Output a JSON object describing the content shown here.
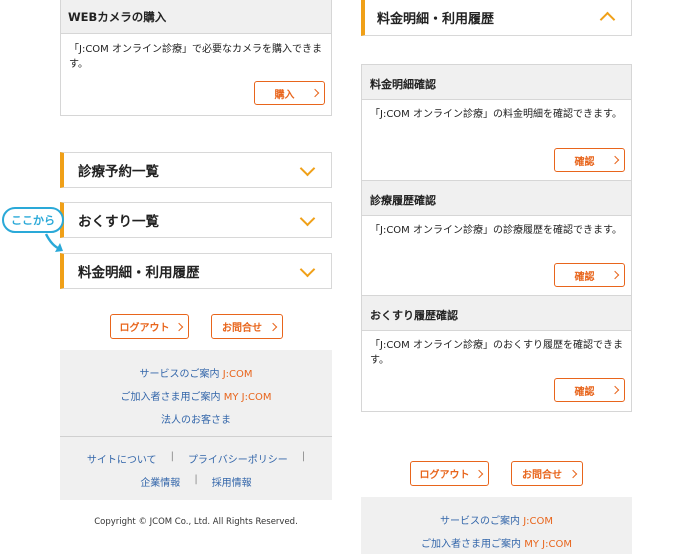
{
  "left": {
    "camera": {
      "title": "WEBカメラの購入",
      "text": "「J:COM オンライン診療」で必要なカメラを購入できます。",
      "button": "購入"
    },
    "accordions": [
      {
        "label": "診療予約一覧"
      },
      {
        "label": "おくすり一覧"
      },
      {
        "label": "料金明細・利用履歴"
      }
    ],
    "callout": "ここから",
    "logout": "ログアウト",
    "contact": "お問合せ",
    "footer": {
      "service_prefix": "サービスのご案内",
      "service_brand": "J:COM",
      "member_prefix": "ご加入者さま用ご案内",
      "member_brand": "MY J:COM",
      "corporate": "法人のお客さま",
      "about": "サイトについて",
      "privacy": "プライバシーポリシー",
      "company": "企業情報",
      "recruit": "採用情報",
      "sep": "|"
    },
    "copyright": "Copyright © JCOM Co., Ltd. All Rights Reserved."
  },
  "right": {
    "header": "料金明細・利用履歴",
    "sections": [
      {
        "title": "料金明細確認",
        "text": "「J:COM オンライン診療」の料金明細を確認できます。",
        "button": "確認"
      },
      {
        "title": "診療履歴確認",
        "text": "「J:COM オンライン診療」の診療履歴を確認できます。",
        "button": "確認"
      },
      {
        "title": "おくすり履歴確認",
        "text": "「J:COM オンライン診療」のおくすり履歴を確認できます。",
        "button": "確認"
      }
    ],
    "logout": "ログアウト",
    "contact": "お問合せ",
    "footer": {
      "service_prefix": "サービスのご案内",
      "service_brand": "J:COM",
      "member_prefix": "ご加入者さま用ご案内",
      "member_brand": "MY J:COM"
    }
  },
  "colors": {
    "accent": "#f0a018",
    "button": "#e8651c",
    "callout": "#2aa9d8",
    "link": "#3366aa"
  }
}
